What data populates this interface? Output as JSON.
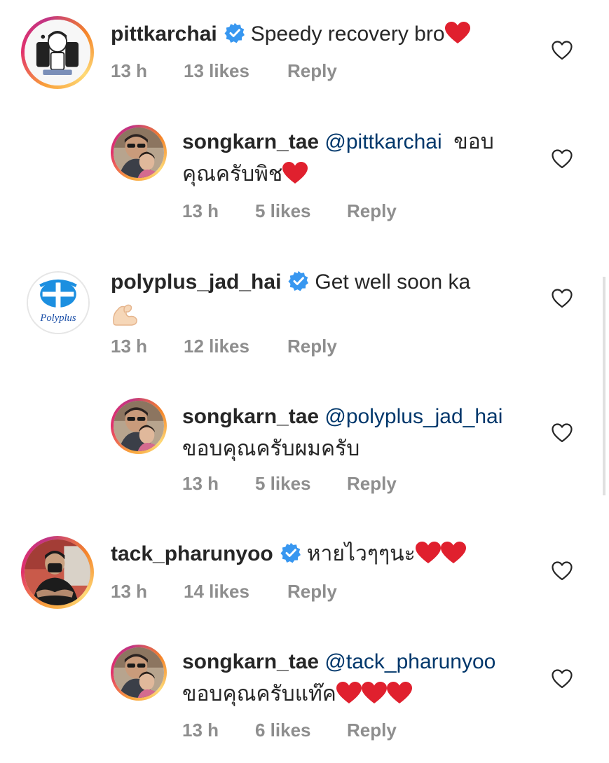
{
  "comments": [
    {
      "username": "pittkarchai",
      "verified": true,
      "text": "Speedy recovery bro",
      "emoji": [
        "red-heart"
      ],
      "time": "13 h",
      "likes": "13 likes",
      "reply": "Reply"
    },
    {
      "username": "songkarn_tae",
      "mention": "@pittkarchai",
      "text_line1": "ขอบ",
      "text_line2": "คุณครับพิช",
      "emoji": [
        "red-heart"
      ],
      "time": "13 h",
      "likes": "5 likes",
      "reply": "Reply"
    },
    {
      "username": "polyplus_jad_hai",
      "verified": true,
      "text": "Get well soon ka",
      "emoji": [
        "flexed-biceps"
      ],
      "time": "13 h",
      "likes": "12 likes",
      "reply": "Reply",
      "avatar_label": "Polyplus"
    },
    {
      "username": "songkarn_tae",
      "mention": "@polyplus_jad_hai",
      "text_line2": "ขอบคุณครับผมครับ",
      "time": "13 h",
      "likes": "5 likes",
      "reply": "Reply"
    },
    {
      "username": "tack_pharunyoo",
      "verified": true,
      "text": "หายไวๆๆนะ",
      "emoji": [
        "red-heart",
        "red-heart"
      ],
      "time": "13 h",
      "likes": "14 likes",
      "reply": "Reply"
    },
    {
      "username": "songkarn_tae",
      "mention": "@tack_pharunyoo",
      "text_line2": "ขอบคุณครับแท๊ค",
      "emoji": [
        "red-heart",
        "red-heart",
        "red-heart"
      ],
      "time": "13 h",
      "likes": "6 likes",
      "reply": "Reply"
    }
  ],
  "colors": {
    "text": "#262626",
    "meta": "#8e8e8e",
    "mention": "#00376b",
    "verified": "#3897f0",
    "heart": "#e0202e"
  },
  "icons": {
    "like": "heart-outline-icon",
    "verified": "verified-badge-icon"
  }
}
